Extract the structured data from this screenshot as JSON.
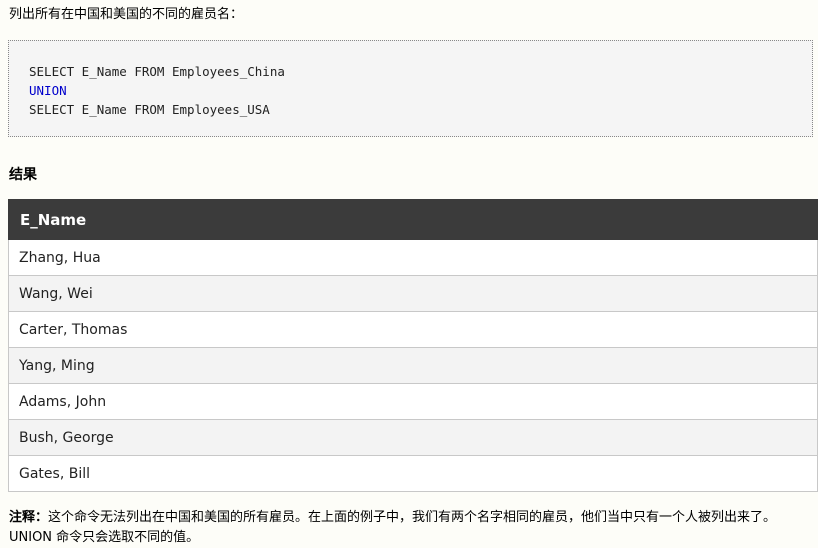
{
  "intro_text": "列出所有在中国和美国的不同的雇员名：",
  "code": {
    "line1": "SELECT E_Name FROM Employees_China",
    "line2": "UNION",
    "line3": "SELECT E_Name FROM Employees_USA",
    "keyword_color": "#0000cc"
  },
  "result_title": "结果",
  "table": {
    "header": "E_Name",
    "rows": [
      "Zhang, Hua",
      "Wang, Wei",
      "Carter, Thomas",
      "Yang, Ming",
      "Adams, John",
      "Bush, George",
      "Gates, Bill"
    ]
  },
  "note": {
    "label": "注释：",
    "text": "这个命令无法列出在中国和美国的所有雇员。在上面的例子中，我们有两个名字相同的雇员，他们当中只有一个人被列出来了。UNION 命令只会选取不同的值。"
  },
  "colors": {
    "page_bg": "#fdfdf8",
    "code_bg": "#f5f5f5",
    "table_header_bg": "#3b3b3b",
    "row_alt_bg": "#f3f3f3"
  }
}
